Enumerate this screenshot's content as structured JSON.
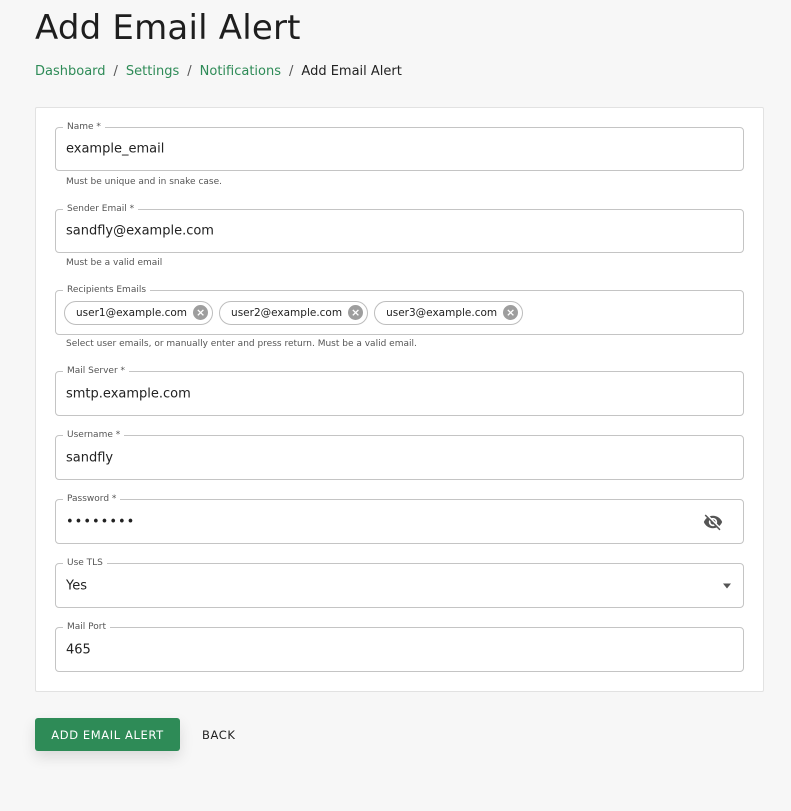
{
  "page": {
    "title": "Add Email Alert"
  },
  "breadcrumb": [
    {
      "label": "Dashboard"
    },
    {
      "label": "Settings"
    },
    {
      "label": "Notifications"
    },
    {
      "label": "Add Email Alert"
    }
  ],
  "breadcrumb_separator": "/",
  "form": {
    "name": {
      "label": "Name *",
      "value": "example_email",
      "helper": "Must be unique and in snake case."
    },
    "sender_email": {
      "label": "Sender Email *",
      "value": "sandfly@example.com",
      "helper": "Must be a valid email"
    },
    "recipients": {
      "label": "Recipients Emails",
      "chips": [
        "user1@example.com",
        "user2@example.com",
        "user3@example.com"
      ],
      "chip_delete_icon": "cancel-circle-icon",
      "helper": "Select user emails, or manually enter and press return. Must be a valid email."
    },
    "mail_server": {
      "label": "Mail Server *",
      "value": "smtp.example.com"
    },
    "username": {
      "label": "Username *",
      "value": "sandfly"
    },
    "password": {
      "label": "Password *",
      "value": "••••••••",
      "toggle_icon": "eye-off-icon"
    },
    "use_tls": {
      "label": "Use TLS",
      "value": "Yes",
      "icon": "caret-down-icon"
    },
    "mail_port": {
      "label": "Mail Port",
      "value": "465"
    }
  },
  "actions": {
    "submit_label": "ADD EMAIL ALERT",
    "back_label": "BACK"
  },
  "colors": {
    "accent": "#2e8b57",
    "border": "#c4c4c4",
    "background": "#f7f7f7"
  }
}
